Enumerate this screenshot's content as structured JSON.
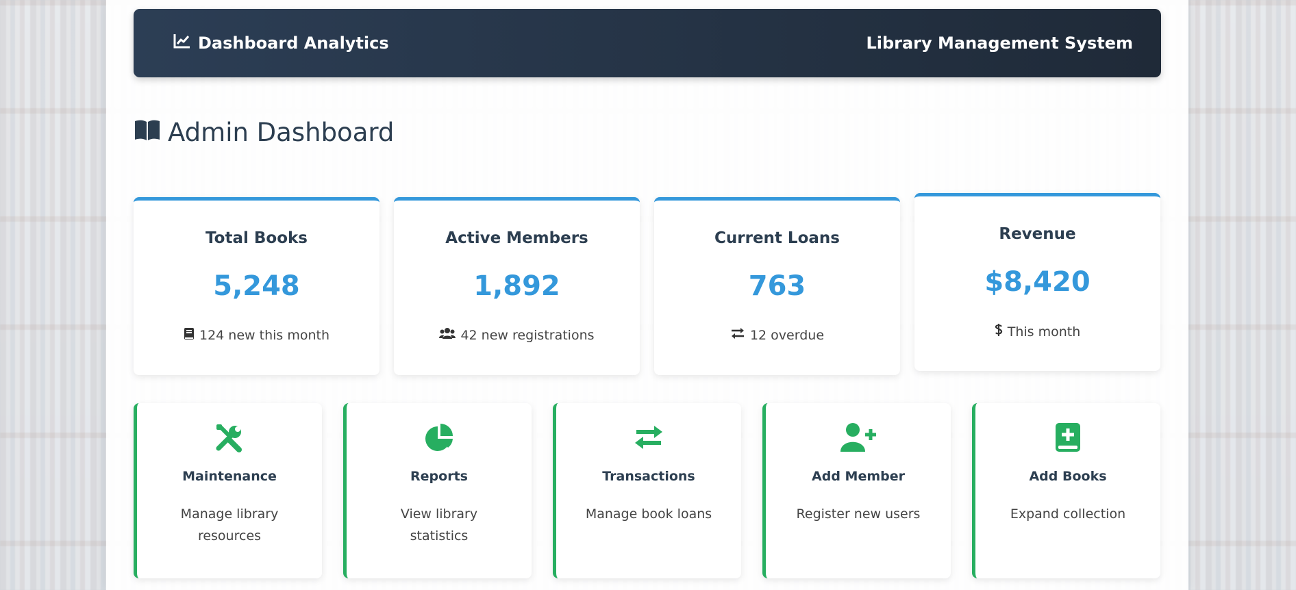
{
  "header": {
    "brand_title": "Dashboard Analytics",
    "system_name": "Library Management System",
    "brand_icon": "chart-line-icon"
  },
  "page": {
    "title": "Admin Dashboard",
    "title_icon": "open-book-icon"
  },
  "stats": [
    {
      "label": "Total Books",
      "value": "5,248",
      "note": "124 new this month",
      "icon": "book-icon"
    },
    {
      "label": "Active Members",
      "value": "1,892",
      "note": "42 new registrations",
      "icon": "users-icon"
    },
    {
      "label": "Current Loans",
      "value": "763",
      "note": "12 overdue",
      "icon": "exchange-icon"
    },
    {
      "label": "Revenue",
      "value": "$8,420",
      "note": "This month",
      "icon": "dollar-icon"
    }
  ],
  "actions": [
    {
      "label": "Maintenance",
      "description": "Manage library resources",
      "icon": "tools-icon"
    },
    {
      "label": "Reports",
      "description": "View library statistics",
      "icon": "pie-chart-icon"
    },
    {
      "label": "Transactions",
      "description": "Manage book loans",
      "icon": "exchange-icon"
    },
    {
      "label": "Add Member",
      "description": "Register new users",
      "icon": "user-plus-icon"
    },
    {
      "label": "Add Books",
      "description": "Expand collection",
      "icon": "book-plus-icon"
    }
  ],
  "colors": {
    "accent_blue": "#3498db",
    "accent_green": "#27ae60",
    "header_dark": "#1f2a38",
    "text_dark": "#2c3e50"
  }
}
